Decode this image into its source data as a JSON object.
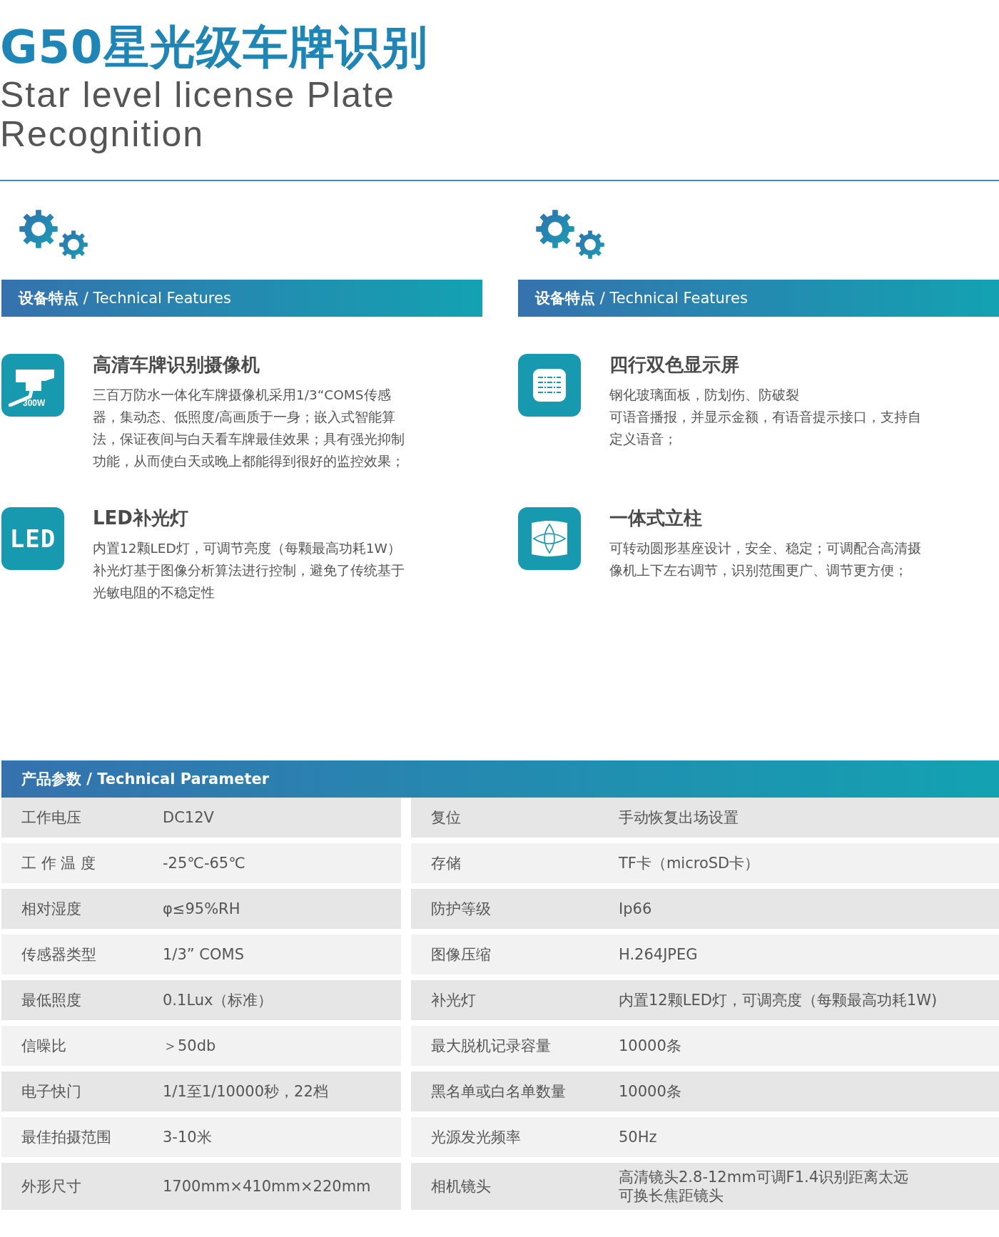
{
  "title": "G50星光级车牌识别",
  "subtitle": "Star level license Plate Recognition",
  "feature_panels": [
    {
      "heading": "**设备特点** / Technical Features",
      "features": [
        {
          "kind": "camera",
          "icon_text": "300W",
          "title": "高清车牌识别摄像机",
          "paragraphs": [
            "三百万防水一体化车牌摄像机采用1/3“COMS传感器，集动态、低照度/高画质于一身；嵌入式智能算法，保证夜间与白天看车牌最佳效果；具有强光抑制功能，从而使白天或晚上都能得到很好的监控效果；"
          ]
        },
        {
          "kind": "led",
          "icon_text": "LED",
          "title": "LED补光灯",
          "paragraphs": [
            "内置12颗LED灯，可调节亮度（每颗最高功耗1W）补光灯基于图像分析算法进行控制，避免了传统基于光敏电阻的不稳定性"
          ]
        }
      ]
    },
    {
      "heading": "**设备特点** / Technical Features",
      "features": [
        {
          "kind": "display",
          "title": "四行双色显示屏",
          "paragraphs": [
            "钢化玻璃面板，防划伤、防破裂",
            "可语音播报，并显示金额，有语音提示接口，支持自定义语音；"
          ]
        },
        {
          "kind": "pillar",
          "title": "一体式立柱",
          "paragraphs": [
            "可转动圆形基座设计，安全、稳定；可调配合高清摄像机上下左右调节，识别范围更广、调节更方便；"
          ]
        }
      ]
    }
  ],
  "parameters": {
    "heading": "**产品参数** / Technical Parameter",
    "rows": [
      [
        {
          "label": "工作电压",
          "value": "DC12V"
        },
        {
          "label": "复位",
          "value": "手动恢复出场设置"
        }
      ],
      [
        {
          "label": "工 作 温 度",
          "value": "-25℃-65℃"
        },
        {
          "label": "存储",
          "value": "TF卡（microSD卡）"
        }
      ],
      [
        {
          "label": "相对湿度",
          "value": "φ≤95%RH"
        },
        {
          "label": "防护等级",
          "value": "Ip66"
        }
      ],
      [
        {
          "label": "传感器类型",
          "value": "1/3” COMS"
        },
        {
          "label": "图像压缩",
          "value": "H.264JPEG"
        }
      ],
      [
        {
          "label": "最低照度",
          "value": "0.1Lux（标准）"
        },
        {
          "label": "补光灯",
          "value": "内置12颗LED灯，可调亮度（每颗最高功耗1W)"
        }
      ],
      [
        {
          "label": "信噪比",
          "value": "＞50db"
        },
        {
          "label": "最大脱机记录容量",
          "value": "10000条"
        }
      ],
      [
        {
          "label": "电子快门",
          "value": "1/1至1/10000秒，22档"
        },
        {
          "label": "黑名单或白名单数量",
          "value": "10000条"
        }
      ],
      [
        {
          "label": "最佳拍摄范围",
          "value": "3-10米"
        },
        {
          "label": "光源发光频率",
          "value": "50Hz"
        }
      ],
      [
        {
          "label": "外形尺寸",
          "value": "1700mm×410mm×220mm"
        },
        {
          "label": "相机镜头",
          "value_lines": [
            "高清镜头2.8-12mm可调F1.4识别距离太远",
            "可换长焦距镜头"
          ]
        }
      ]
    ]
  }
}
